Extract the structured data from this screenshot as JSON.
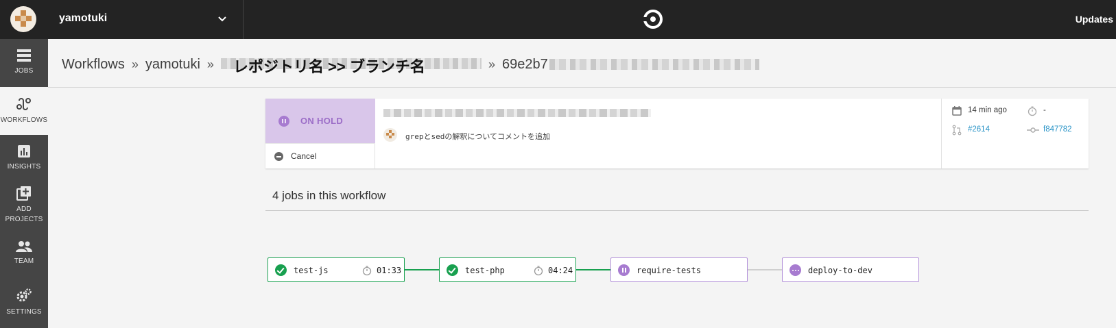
{
  "topbar": {
    "org_name": "yamotuki",
    "updates_label": "Updates"
  },
  "sidebar": {
    "items": [
      {
        "label": "JOBS",
        "icon": "list-icon"
      },
      {
        "label": "WORKFLOWS",
        "icon": "workflow-icon",
        "active": true
      },
      {
        "label": "INSIGHTS",
        "icon": "bar-chart-icon"
      },
      {
        "label": "ADD\nPROJECTS",
        "icon": "add-library-icon"
      },
      {
        "label": "TEAM",
        "icon": "people-icon"
      },
      {
        "label": "SETTINGS",
        "icon": "gears-icon"
      }
    ]
  },
  "breadcrumb": {
    "workflows": "Workflows",
    "org": "yamotuki",
    "repo_branch": "レポジトリ名 >> ブランチ名",
    "sha_prefix": "69e2b7",
    "separator": "»"
  },
  "summary": {
    "status": "ON HOLD",
    "cancel_label": "Cancel",
    "commit_message": "grepとsedの解釈についてコメントを追加",
    "started": "14 min ago",
    "duration": "-",
    "pr_number": "#2614",
    "commit_sha": "f847782"
  },
  "jobs": {
    "title": "4 jobs in this workflow",
    "items": [
      {
        "name": "test-js",
        "status": "success",
        "duration": "01:33"
      },
      {
        "name": "test-php",
        "status": "success",
        "duration": "04:24"
      },
      {
        "name": "require-tests",
        "status": "on-hold"
      },
      {
        "name": "deploy-to-dev",
        "status": "pending"
      }
    ]
  },
  "colors": {
    "topbar": "#232323",
    "sidebar": "#454545",
    "success": "#18a04f",
    "hold": "#a77bd0",
    "hold_bg": "#d9c6ea",
    "link": "#2a94c7"
  }
}
